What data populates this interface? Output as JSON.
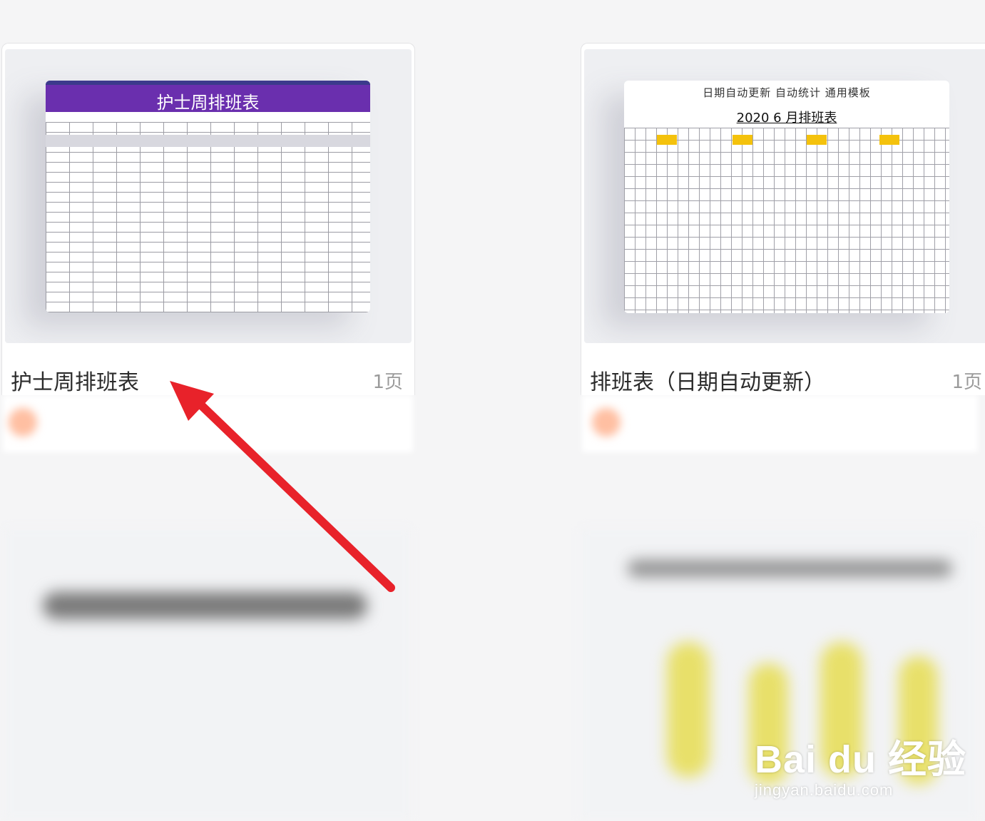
{
  "cards": [
    {
      "title": "护士周排班表",
      "pages": "1页",
      "thumbnail": {
        "sheet_title": "护士周排班表"
      }
    },
    {
      "title": "排班表（日期自动更新）",
      "pages": "1页",
      "thumbnail": {
        "subtitle": "日期自动更新   自动统计   通用模板",
        "sheet_title": "2020 6 月排班表"
      }
    }
  ],
  "watermark": {
    "brand": "Bai du 经验",
    "url": "jingyan.baidu.com"
  },
  "colors": {
    "arrow": "#e8222a",
    "header_purple": "#6a2fae",
    "highlight_yellow": "#f4c20d"
  },
  "icons": [
    "red-arrow-icon",
    "baidu-paw-icon"
  ]
}
